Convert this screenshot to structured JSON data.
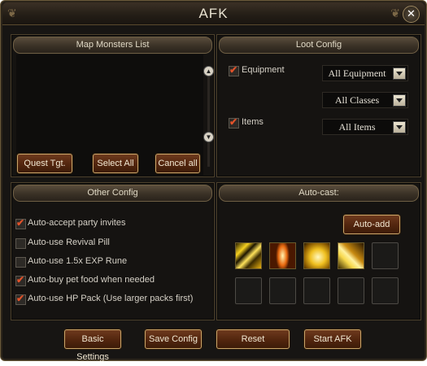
{
  "window": {
    "title": "AFK"
  },
  "map_monsters": {
    "header": "Map Monsters List",
    "buttons": {
      "quest_tgt": "Quest Tgt.",
      "select_all": "Select All",
      "cancel_all": "Cancel all"
    }
  },
  "loot": {
    "header": "Loot Config",
    "equipment": {
      "label": "Equipment",
      "checked": true,
      "value": "All Equipment"
    },
    "classes": {
      "value": "All Classes"
    },
    "items": {
      "label": "Items",
      "checked": true,
      "value": "All Items"
    }
  },
  "other": {
    "header": "Other Config",
    "options": [
      {
        "label": "Auto-accept party invites",
        "checked": true
      },
      {
        "label": "Auto-use Revival Pill",
        "checked": false
      },
      {
        "label": "Auto-use 1.5x EXP Rune",
        "checked": false
      },
      {
        "label": "Auto-buy pet food when needed",
        "checked": true
      },
      {
        "label": "Auto-use HP Pack (Use larger packs first)",
        "checked": true
      }
    ]
  },
  "autocast": {
    "header": "Auto-cast:",
    "auto_add": "Auto-add",
    "skills": [
      "claw-strike-skill-icon",
      "flame-spear-skill-icon",
      "golden-radiance-skill-icon",
      "lightning-slash-skill-icon"
    ]
  },
  "footer": {
    "basic_settings": "Basic Settings",
    "save_config": "Save Config",
    "reset": "Reset",
    "start_afk": "Start AFK"
  },
  "colors": {
    "check": "#e0522a",
    "button_border": "#c9a56a",
    "button_fill": "#54270f"
  }
}
